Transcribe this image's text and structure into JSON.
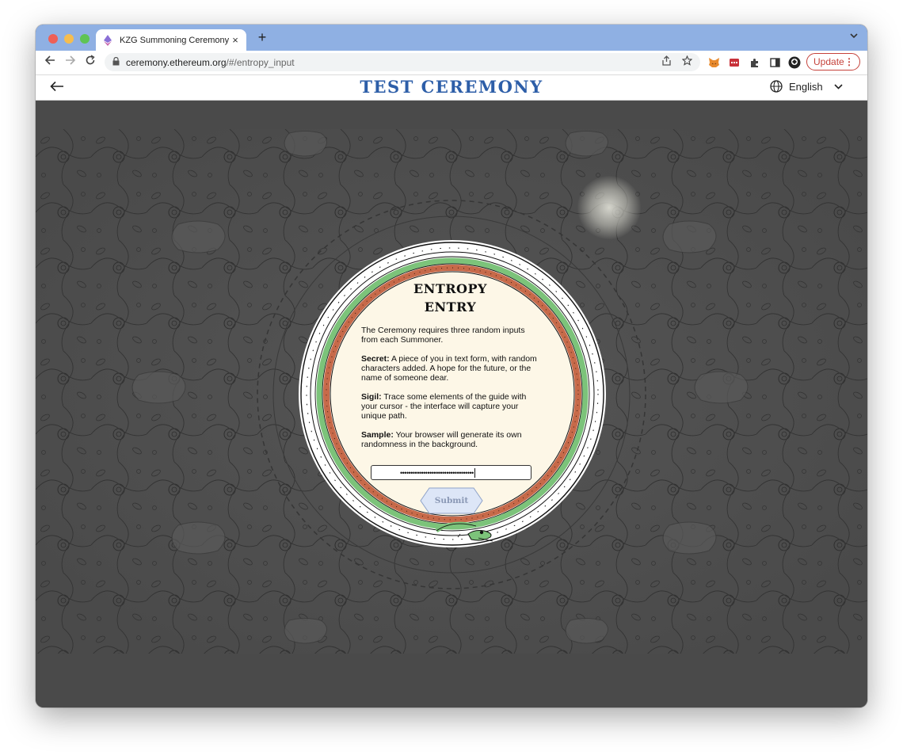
{
  "browser": {
    "tab_title": "KZG Summoning Ceremony",
    "tab_close": "×",
    "new_tab": "+",
    "tab_menu": "⌄",
    "url_host": "ceremony.ethereum.org",
    "url_path": "/#/entropy_input",
    "update_label": "Update",
    "update_menu": "⋮"
  },
  "app": {
    "title": "TEST CEREMONY",
    "language": "English"
  },
  "card": {
    "title_line1": "ENTROPY",
    "title_line2": "ENTRY",
    "intro": "The Ceremony requires three random inputs from each Summoner.",
    "secret_label": "Secret:",
    "secret_text": " A piece of you in text form, with random characters added. A hope for the future, or the name of someone dear.",
    "sigil_label": "Sigil:",
    "sigil_text": " Trace some elements of the guide with your cursor - the interface will capture your unique path.",
    "sample_label": "Sample:",
    "sample_text": " Your browser will generate its own randomness in the background.",
    "input_value": "•••••••••••••••••••••••••••••••••••",
    "submit_label": "Submit"
  },
  "colors": {
    "title_blue": "#2d5ea8",
    "card_cream": "#fdf7e7",
    "ring_green": "#7cc37a",
    "ring_rust": "#c76a4a",
    "background": "#4a4a4a",
    "update_red": "#c5423b"
  }
}
